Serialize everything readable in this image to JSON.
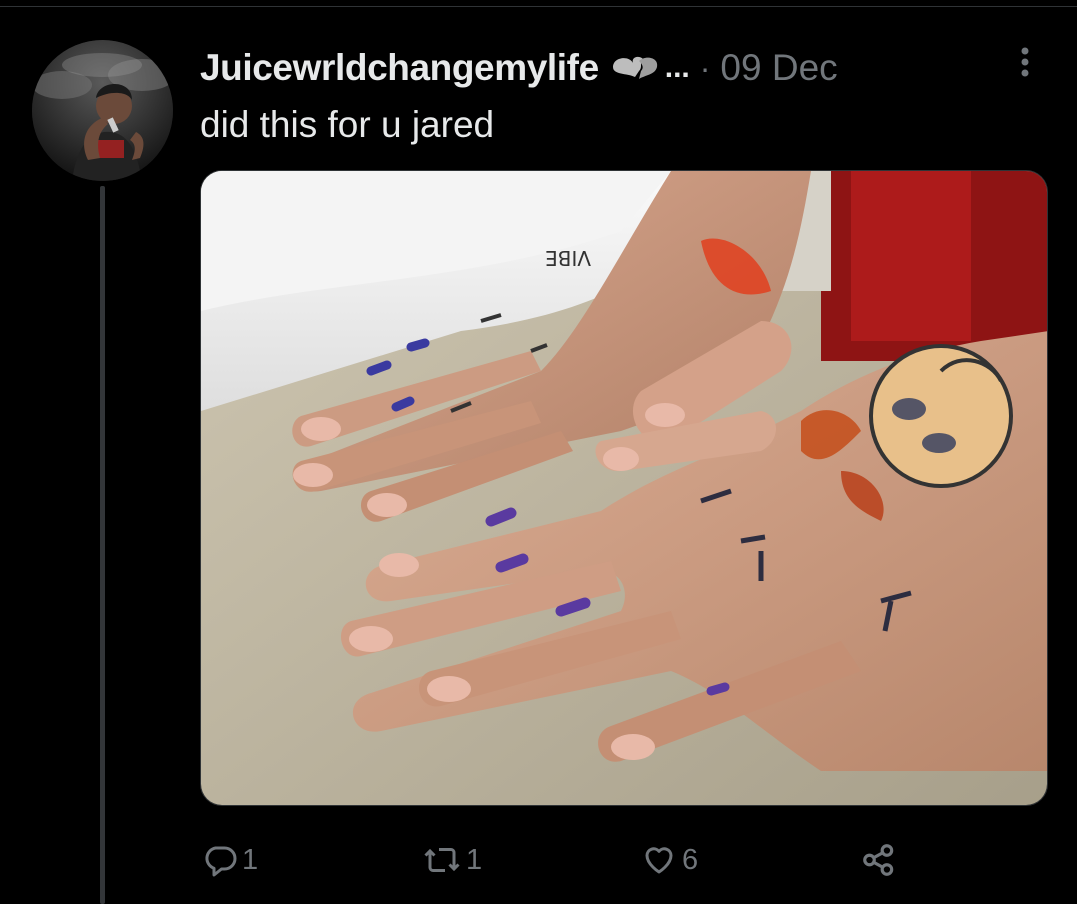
{
  "tweet": {
    "author_name": "Juicewrldchangemylife",
    "emoji_icon": "broken-heart-emoji",
    "name_truncation": "...",
    "separator": "·",
    "date": "09 Dec",
    "text": "did this for u jared",
    "media": {
      "subject": "two hands with drawn marker doodles on a bathroom counter",
      "photo_icon": "hand-doodles-photo"
    }
  },
  "actions": {
    "reply": {
      "icon": "reply-icon",
      "count": "1"
    },
    "retweet": {
      "icon": "retweet-icon",
      "count": "1"
    },
    "like": {
      "icon": "heart-icon",
      "count": "6"
    },
    "share": {
      "icon": "share-icon"
    }
  },
  "colors": {
    "background": "#000000",
    "primary_text": "#e7e9ea",
    "secondary_text": "#71767b",
    "divider": "#2f3336"
  }
}
